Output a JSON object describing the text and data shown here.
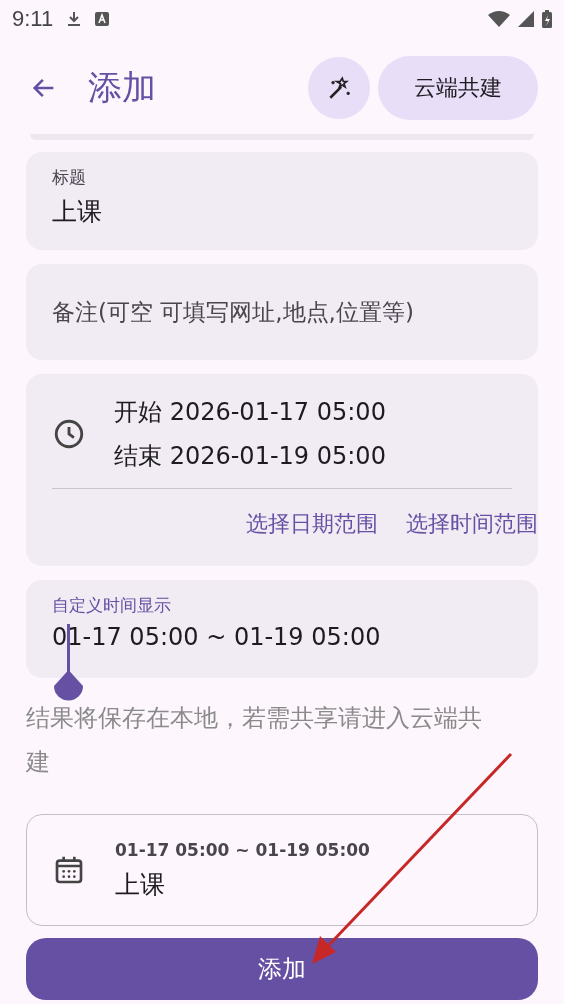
{
  "status_bar": {
    "time": "9:11"
  },
  "app_bar": {
    "title": "添加",
    "cloud_button": "云端共建"
  },
  "title_field": {
    "label": "标题",
    "value": "上课"
  },
  "note_field": {
    "placeholder": "备注(可空 可填写网址,地点,位置等)"
  },
  "time_card": {
    "start": "开始 2026-01-17 05:00",
    "end": "结束 2026-01-19 05:00",
    "actions": [
      "选择日期范围",
      "选择时间范围"
    ]
  },
  "custom_field": {
    "label": "自定义时间显示",
    "value": "01-17 05:00 ~ 01-19 05:00",
    "focused": true
  },
  "hint": "结果将保存在本地，若需共享请进入云端共建",
  "preview": {
    "time": "01-17 05:00 ~ 01-19 05:00",
    "title": "上课"
  },
  "submit_button": "添加"
}
